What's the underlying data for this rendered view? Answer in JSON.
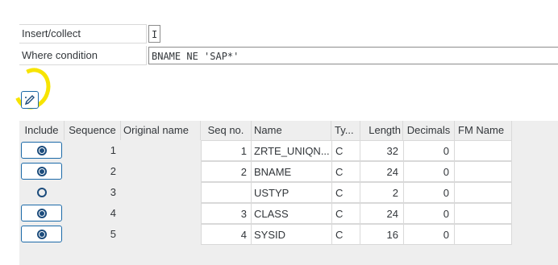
{
  "form": {
    "insert_label": "Insert/collect",
    "insert_value": "I",
    "where_label": "Where condition",
    "where_value": "BNAME NE 'SAP*'"
  },
  "toolbar": {
    "edit_icon": "pencil-edit-icon"
  },
  "table": {
    "headers": {
      "include": "Include",
      "sequence": "Sequence",
      "original_name": "Original name",
      "seq_no": "Seq no.",
      "name": "Name",
      "type": "Ty...",
      "length": "Length",
      "decimals": "Decimals",
      "fm_name": "FM Name"
    },
    "rows": [
      {
        "include": true,
        "sequence": "1",
        "original_name": "",
        "seq_no": "1",
        "name": "ZRTE_UNIQN...",
        "type": "C",
        "length": "32",
        "decimals": "0",
        "fm_name": ""
      },
      {
        "include": true,
        "sequence": "2",
        "original_name": "",
        "seq_no": "2",
        "name": "BNAME",
        "type": "C",
        "length": "24",
        "decimals": "0",
        "fm_name": ""
      },
      {
        "include": false,
        "sequence": "3",
        "original_name": "",
        "seq_no": "",
        "name": "USTYP",
        "type": "C",
        "length": "2",
        "decimals": "0",
        "fm_name": ""
      },
      {
        "include": true,
        "sequence": "4",
        "original_name": "",
        "seq_no": "3",
        "name": "CLASS",
        "type": "C",
        "length": "24",
        "decimals": "0",
        "fm_name": ""
      },
      {
        "include": true,
        "sequence": "5",
        "original_name": "",
        "seq_no": "4",
        "name": "SYSID",
        "type": "C",
        "length": "16",
        "decimals": "0",
        "fm_name": ""
      }
    ]
  }
}
